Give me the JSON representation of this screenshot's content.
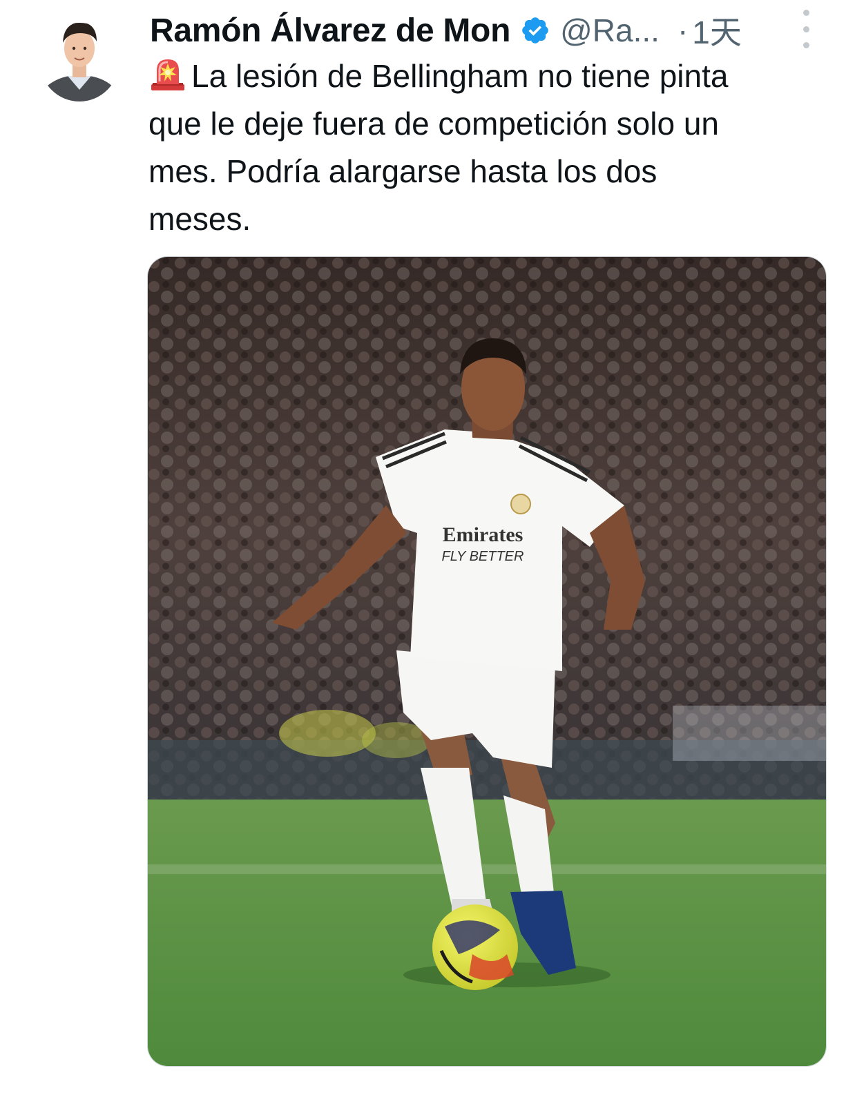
{
  "tweet": {
    "author": {
      "display_name": "Ramón Álvarez de Mon",
      "handle": "@Ra...",
      "verified": true,
      "avatar_icon": "author-avatar"
    },
    "separator": "·",
    "time": "1天",
    "more_icon": "more-vertical-icon",
    "text": {
      "emoji": "rotating-light-siren",
      "lines": [
        "La lesión de Bellingham no tiene pinta",
        "que le deje fuera de competición solo un",
        "mes. Podría alargarse hasta los dos",
        "meses."
      ]
    },
    "media": {
      "kind": "photo",
      "jersey_sponsor": "Emirates",
      "jersey_tagline": "FLY BETTER"
    }
  },
  "colors": {
    "text": "#0f1419",
    "secondary": "#536471",
    "verified_blue": "#1d9bf0",
    "border": "#cfd9de"
  }
}
